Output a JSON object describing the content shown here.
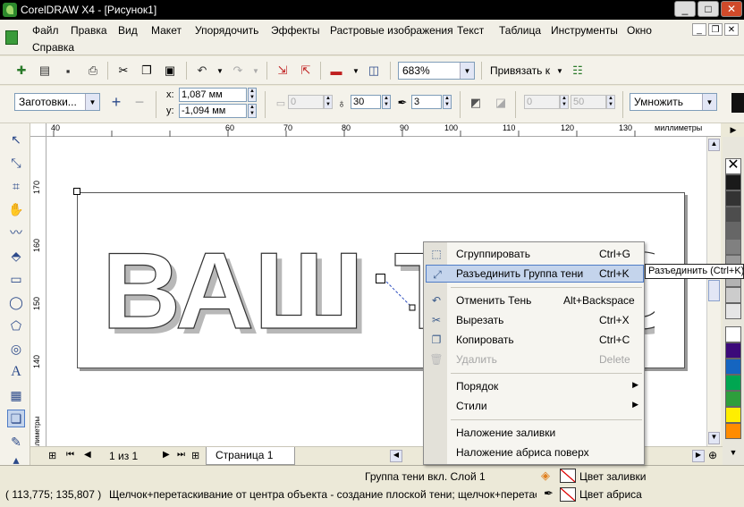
{
  "window": {
    "title": "CorelDRAW X4 - [Рисунок1]"
  },
  "menu": {
    "row1": [
      "Файл",
      "Правка",
      "Вид",
      "Макет",
      "Упорядочить",
      "Эффекты",
      "Растровые изображения",
      "Текст",
      "Таблица",
      "Инструменты",
      "Окно"
    ],
    "row2": [
      "Справка"
    ]
  },
  "standard_toolbar": {
    "zoom": "683%",
    "snap_label": "Привязать к"
  },
  "property_bar": {
    "preset": "Заготовки...",
    "x": "1,087 мм",
    "y": "-1,094 мм",
    "shadow_offset": "0",
    "shadow_opacity": "30",
    "shadow_feather": "3",
    "fade": "0",
    "stretch": "50",
    "blend_mode": "Умножить"
  },
  "ruler": {
    "unit": "миллиметры",
    "h_ticks": [
      "40",
      "60",
      "70",
      "80",
      "90",
      "100",
      "110",
      "120",
      "130"
    ],
    "v_ticks": [
      "170",
      "160",
      "150",
      "140"
    ]
  },
  "canvas": {
    "text": "ВАШ ТЕКСТ"
  },
  "page_nav": {
    "counter": "1 из 1",
    "tab": "Страница 1"
  },
  "context_menu": {
    "items": [
      {
        "label": "Сгруппировать",
        "shortcut": "Ctrl+G",
        "icon": "group-icon"
      },
      {
        "label": "Разъединить Группа тени",
        "shortcut": "Ctrl+K",
        "icon": "break-apart-icon"
      },
      {
        "label": "Отменить Тень",
        "shortcut": "Alt+Backspace",
        "icon": "undo-icon"
      },
      {
        "label": "Вырезать",
        "shortcut": "Ctrl+X",
        "icon": "cut-icon"
      },
      {
        "label": "Копировать",
        "shortcut": "Ctrl+C",
        "icon": "copy-icon"
      },
      {
        "label": "Удалить",
        "shortcut": "Delete",
        "icon": "delete-icon"
      },
      {
        "label": "Порядок",
        "icon": "order-icon"
      },
      {
        "label": "Стили",
        "icon": "styles-icon"
      },
      {
        "label": "Наложение заливки",
        "icon": "overprint-fill-icon"
      },
      {
        "label": "Наложение абриса поверх",
        "icon": "overprint-outline-icon"
      }
    ]
  },
  "tooltip": "Разъединить (Ctrl+K)",
  "status": {
    "object_info": "Группа тени  вкл. Слой 1",
    "fill_label": "Цвет заливки",
    "outline_label": "Цвет абриса",
    "coords": "( 113,775; 135,807 )",
    "hint": "Щелчок+перетаскивание от центра объекта - создание плоской тени; щелчок+перетаски..."
  },
  "palette_colors": [
    "#ffffff",
    "#1a1a1a",
    "#333333",
    "#4d4d4d",
    "#666666",
    "#808080",
    "#999999",
    "#b3b3b3",
    "#cccccc",
    "#e6e6e6",
    "#ffffff",
    "#3c0a7a",
    "#1565c0",
    "#00a651",
    "#2e9e3c",
    "#ffee00",
    "#ff8c00",
    "#e60000",
    "#e30f6f"
  ]
}
